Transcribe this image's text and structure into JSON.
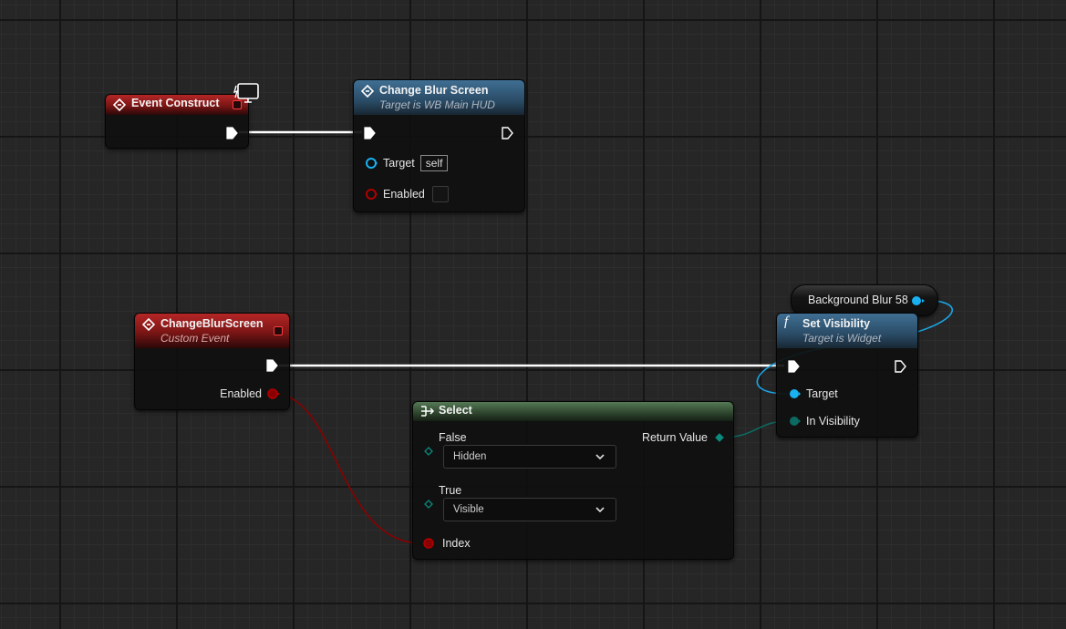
{
  "event_construct": {
    "title": "Event Construct"
  },
  "change_blur_call": {
    "title": "Change Blur Screen",
    "subtitle": "Target is WB Main HUD",
    "pins": {
      "target_label": "Target",
      "target_value": "self",
      "enabled_label": "Enabled"
    }
  },
  "custom_event": {
    "title": "ChangeBlurScreen",
    "subtitle": "Custom Event",
    "pins": {
      "enabled_label": "Enabled"
    }
  },
  "variable_node": {
    "label": "Background Blur 58"
  },
  "set_visibility": {
    "title": "Set Visibility",
    "subtitle": "Target is Widget",
    "pins": {
      "target_label": "Target",
      "in_visibility_label": "In Visibility"
    }
  },
  "select": {
    "title": "Select",
    "false_label": "False",
    "false_value": "Hidden",
    "true_label": "True",
    "true_value": "Visible",
    "index_label": "Index",
    "return_label": "Return Value"
  },
  "colors": {
    "exec_wire": "#ffffff",
    "bool_pin": "#950000",
    "object_pin": "#19b1f2",
    "enum_pin": "#0b6b62",
    "event_header": "#a11f1f",
    "function_header": "#3b6585",
    "pure_header": "#4e6e4e"
  },
  "icons": {
    "event": "event-diamond-icon",
    "function": "function-f-icon",
    "select": "select-icon",
    "client": "client-monitor-icon",
    "dropdown": "chevron-down-icon"
  }
}
